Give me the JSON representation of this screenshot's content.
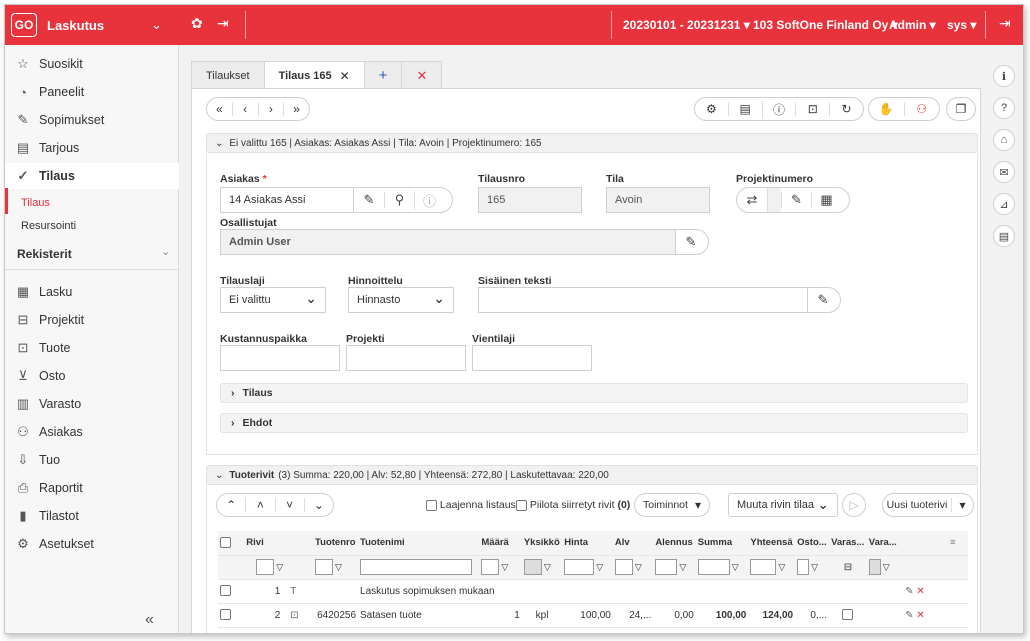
{
  "topbar": {
    "logo": "GO",
    "app_name": "Laskutus",
    "period": "20230101 - 20231231",
    "company": "103 SoftOne Finland Oy",
    "user": "Admin",
    "role": "sys"
  },
  "sidebar": {
    "items": [
      {
        "label": "Suosikit",
        "icon": "☆"
      },
      {
        "label": "Paneelit",
        "icon": "◔"
      },
      {
        "label": "Sopimukset",
        "icon": "✎"
      },
      {
        "label": "Tarjous",
        "icon": "▤"
      },
      {
        "label": "Tilaus",
        "icon": "✓"
      }
    ],
    "sub_items": [
      "Tilaus",
      "Resursointi"
    ],
    "group": "Rekisterit",
    "items2": [
      {
        "label": "Lasku",
        "icon": "▦"
      },
      {
        "label": "Projektit",
        "icon": "⊟"
      },
      {
        "label": "Tuote",
        "icon": "⊡"
      },
      {
        "label": "Osto",
        "icon": "⊻"
      },
      {
        "label": "Varasto",
        "icon": "▥"
      },
      {
        "label": "Asiakas",
        "icon": "⚇"
      },
      {
        "label": "Tuo",
        "icon": "⇩"
      },
      {
        "label": "Raportit",
        "icon": "⎙"
      },
      {
        "label": "Tilastot",
        "icon": "▮"
      },
      {
        "label": "Asetukset",
        "icon": "⚙"
      }
    ],
    "collapse": "«"
  },
  "tabs": {
    "t1": "Tilaukset",
    "t2": "Tilaus 165",
    "t2_close": "✕",
    "plus": "+",
    "close": "✕"
  },
  "section1": {
    "title": "Ei valittu 165 | Asiakas: Asiakas Assi | Tila: Avoin | Projektinumero: 165"
  },
  "form": {
    "asiakas_label": "Asiakas",
    "asiakas_req": "*",
    "asiakas_value": "14 Asiakas Assi",
    "tilausnro_label": "Tilausnro",
    "tilausnro_value": "165",
    "tila_label": "Tila",
    "tila_value": "Avoin",
    "projektinumero_label": "Projektinumero",
    "osallistujat_label": "Osallistujat",
    "osallistujat_value": "Admin User",
    "tilauslaji_label": "Tilauslaji",
    "tilauslaji_value": "Ei valittu",
    "hinnoittelu_label": "Hinnoittelu",
    "hinnoittelu_value": "Hinnasto",
    "sisainen_label": "Sisäinen teksti",
    "kustannus_label": "Kustannuspaikka",
    "projekti_label": "Projekti",
    "vientilaji_label": "Vientilaji",
    "tilaus_section": "Tilaus",
    "ehdot_section": "Ehdot"
  },
  "rows_section": {
    "title": "Tuoterivit",
    "summary": "(3) Summa: 220,00 | Alv: 52,80 | Yhteensä: 272,80 | Laskutettavaa: 220,00",
    "laajenna": "Laajenna listaus",
    "piilota": "Piilota siirretyt rivit",
    "piilota_count": "(0)",
    "toiminnot": "Toiminnot",
    "muuta": "Muuta rivin tilaa",
    "uusi": "Uusi tuoterivi"
  },
  "grid": {
    "headers": [
      "Rivi",
      "Tuotenro",
      "Tuotenimi",
      "Määrä",
      "Yksikkö",
      "Hinta",
      "Alv",
      "Alennus",
      "Summa",
      "Yhteensä",
      "Osto...",
      "Varas...",
      "Vara..."
    ],
    "rows": [
      {
        "rivi": "1",
        "tuotenro": "",
        "tuotenimi": "Laskutus sopimuksen mukaan",
        "maara": "",
        "yksikko": "",
        "hinta": "",
        "alv": "",
        "alennus": "",
        "summa": "",
        "yhteensa": "",
        "osto": ""
      },
      {
        "rivi": "2",
        "tuotenro": "6420256",
        "tuotenimi": "Satasen tuote",
        "maara": "1",
        "yksikko": "kpl",
        "hinta": "100,00",
        "alv": "24,...",
        "alennus": "0,00",
        "summa": "100,00",
        "yhteensa": "124,00",
        "osto": "0,..."
      }
    ]
  },
  "colors": {
    "accent": "#e8323c"
  }
}
